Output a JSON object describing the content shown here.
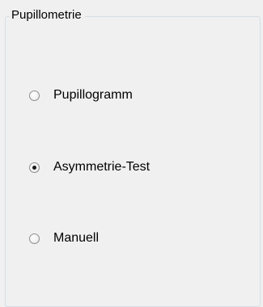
{
  "group": {
    "title": "Pupillometrie"
  },
  "options": [
    {
      "label": "Pupillogramm",
      "checked": false
    },
    {
      "label": "Asymmetrie-Test",
      "checked": true
    },
    {
      "label": "Manuell",
      "checked": false
    }
  ]
}
